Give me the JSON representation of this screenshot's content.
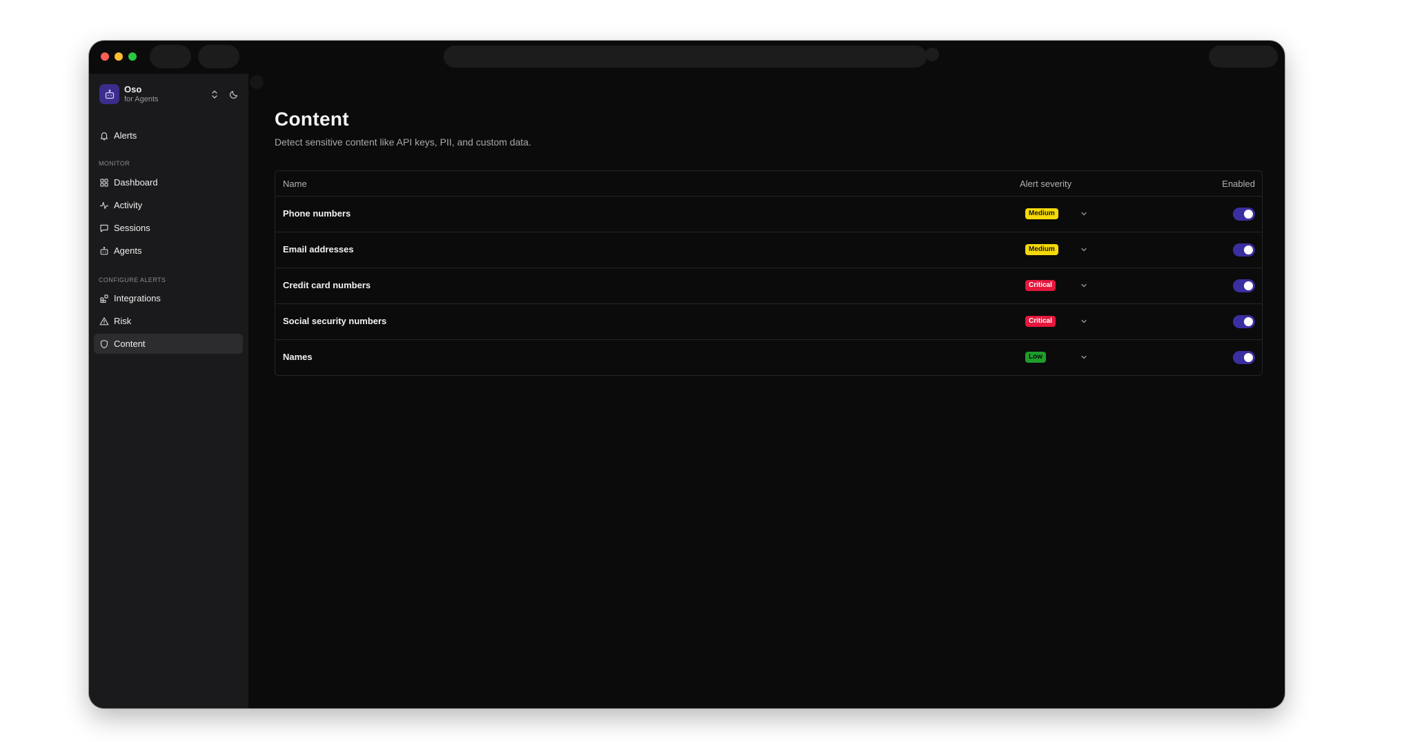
{
  "brand": {
    "name": "Oso",
    "subtitle": "for Agents",
    "icon": "robot-icon",
    "accent": "#3a2d8c"
  },
  "sidebar": {
    "top_items": [
      {
        "label": "Alerts",
        "icon": "bell-icon"
      }
    ],
    "sections": [
      {
        "label": "MONITOR",
        "items": [
          {
            "label": "Dashboard",
            "icon": "grid-icon"
          },
          {
            "label": "Activity",
            "icon": "activity-icon"
          },
          {
            "label": "Sessions",
            "icon": "chat-icon"
          },
          {
            "label": "Agents",
            "icon": "robot-icon"
          }
        ]
      },
      {
        "label": "CONFIGURE ALERTS",
        "items": [
          {
            "label": "Integrations",
            "icon": "blocks-icon"
          },
          {
            "label": "Risk",
            "icon": "warning-icon"
          },
          {
            "label": "Content",
            "icon": "shield-icon",
            "active": true
          }
        ]
      }
    ]
  },
  "page": {
    "title": "Content",
    "subtitle": "Detect sensitive content like API keys, PII, and custom data."
  },
  "table": {
    "columns": {
      "name": "Name",
      "severity": "Alert severity",
      "enabled": "Enabled"
    },
    "rows": [
      {
        "name": "Phone numbers",
        "severity": "Medium",
        "enabled": true
      },
      {
        "name": "Email addresses",
        "severity": "Medium",
        "enabled": true
      },
      {
        "name": "Credit card numbers",
        "severity": "Critical",
        "enabled": true
      },
      {
        "name": "Social security numbers",
        "severity": "Critical",
        "enabled": true
      },
      {
        "name": "Names",
        "severity": "Low",
        "enabled": true
      }
    ]
  },
  "colors": {
    "severity": {
      "Medium": {
        "bg": "#f5d90a",
        "fg": "#1a1a1a"
      },
      "Critical": {
        "bg": "#e5173d",
        "fg": "#ffffff"
      },
      "Low": {
        "bg": "#1f9d2b",
        "fg": "#0a0a0a"
      }
    },
    "toggle_on": "#3a2fa0"
  }
}
